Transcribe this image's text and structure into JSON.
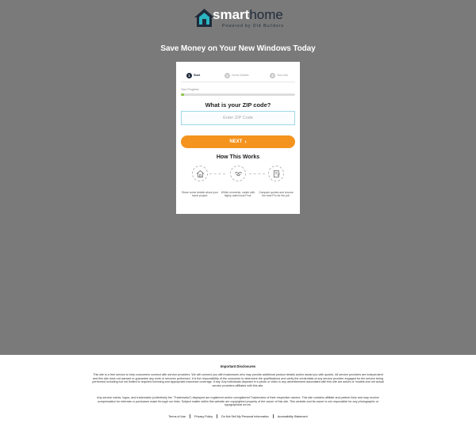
{
  "brand": {
    "name_part1": "smart",
    "name_part2": "home",
    "tagline": "Powered by Old Builders",
    "colors": {
      "teal": "#2bb3c0",
      "navy": "#1f2a3a"
    }
  },
  "headline": "Save Money on Your New Windows Today",
  "form": {
    "steps": [
      {
        "number": "1",
        "label": "Start",
        "state": "active"
      },
      {
        "number": "2",
        "label": "Home Details",
        "state": "inactive"
      },
      {
        "number": "3",
        "label": "Your Info",
        "state": "inactive"
      }
    ],
    "progress_label": "Your Progress",
    "progress_fraction": 0.03,
    "question": "What is your ZIP code?",
    "zip_placeholder": "Enter ZIP Code",
    "zip_value": "",
    "next_label": "NEXT",
    "next_icon": "chevron-right-icon",
    "progress_color": "#8ac33d",
    "button_color": "#f4931e"
  },
  "how_it_works": {
    "title": "How This Works",
    "items": [
      {
        "icon": "house-icon",
        "text": "Share some details about your home project."
      },
      {
        "icon": "handshake-icon",
        "text": "Within moments, match with highly-rated local Pros."
      },
      {
        "icon": "quote-document-icon",
        "text": "Compare quotes and choose the best Pro for the job."
      }
    ]
  },
  "footer": {
    "title": "Important Disclosures",
    "paragraph1": "This site is a free service to help consumers connect with service providers. We will connect you with businesses who may provide additional product details and/or assist you with quotes. All service providers are independent and this site does not warrant or guarantee any work or services performed. It is the responsibility of the consumer to determine the qualifications and verify the credentials of any service provider engaged for the service being performed including but not limited to required licensing and appropriate insurance coverage, if any.  Any individuals depicted in a photo or video in any advertisement associated with this site are actors or models and not actual service providers affiliated with this site.",
    "paragraph2": "Any service marks, logos, and trademarks (collectively the \"Trademarks\") displayed are registered and/or unregistered Trademarks of their respective owners.  This site contains affiliate and partner links and may receive compensation for referrals or purchases made through our links. Subject matter within this website are copyrighted property of the owner of this site.  This website and its owner is not responsible for any photographic or typographical errors.",
    "links": {
      "terms": "Terms of Use",
      "privacy": "Privacy Policy",
      "do_not_sell": "Do Not Sell My Personal Information",
      "accessibility": "Accessibility Statement"
    }
  }
}
